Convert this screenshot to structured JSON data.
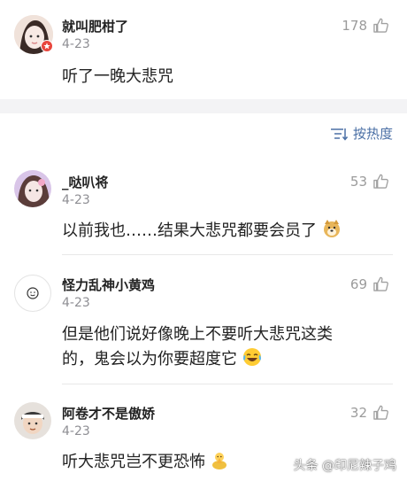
{
  "top_comment": {
    "username": "就叫肥柑了",
    "date": "4-23",
    "likes": "178",
    "text": "听了一晚大悲咒"
  },
  "sort": {
    "label": "按热度"
  },
  "comments": [
    {
      "username": "_哒叭将",
      "date": "4-23",
      "likes": "53",
      "text": "以前我也……结果大悲咒都要会员了",
      "emoji": "doge-emoji"
    },
    {
      "username": "怪力乱神小黄鸡",
      "date": "4-23",
      "likes": "69",
      "text_line1": "但是他们说好像晚上不要听大悲咒这类",
      "text_line2": "的，鬼会以为你要超度它",
      "emoji": "laugh-cry-emoji"
    },
    {
      "username": "阿卷才不是傲娇",
      "date": "4-23",
      "likes": "32",
      "text": "听大悲咒岂不更恐怖",
      "emoji": "praying-emoji"
    }
  ],
  "watermark": "头条 @印尼辣子鸡",
  "colors": {
    "link": "#4a6fa5",
    "muted": "#8e8e93",
    "badge": "#e8453c"
  }
}
